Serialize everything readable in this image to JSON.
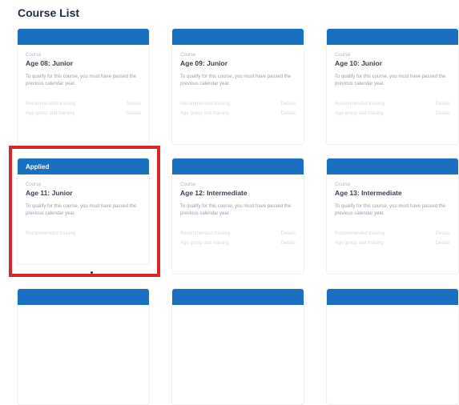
{
  "page": {
    "title": "Course List"
  },
  "courses": [
    {
      "header": "",
      "eyebrow": "Course",
      "title": "Age 08: Junior",
      "desc": "To qualify for this course, you must have passed the previous calendar year.",
      "row1_label": "Recommended training",
      "row1_value": "Details",
      "row2_label": "Age group and training",
      "row2_value": "Details"
    },
    {
      "header": "",
      "eyebrow": "Course",
      "title": "Age 09: Junior",
      "desc": "To qualify for this course, you must have passed the previous calendar year.",
      "row1_label": "Recommended training",
      "row1_value": "Details",
      "row2_label": "Age group and training",
      "row2_value": "Details"
    },
    {
      "header": "",
      "eyebrow": "Course",
      "title": "Age 10: Junior",
      "desc": "To qualify for this course, you must have passed the previous calendar year.",
      "row1_label": "Recommended training",
      "row1_value": "Details",
      "row2_label": "Age group and training",
      "row2_value": "Details"
    },
    {
      "header": "Applied",
      "eyebrow": "Course",
      "title": "Age 11: Junior",
      "desc": "To qualify for this course, you must have passed the previous calendar year.",
      "row1_label": "Recommended training",
      "row1_value": "",
      "row2_label": "",
      "row2_value": ""
    },
    {
      "header": "",
      "eyebrow": "Course",
      "title": "Age 12: Intermediate",
      "desc": "To qualify for this course, you must have passed the previous calendar year.",
      "row1_label": "Recommended training",
      "row1_value": "Details",
      "row2_label": "Age group and training",
      "row2_value": "Details"
    },
    {
      "header": "",
      "eyebrow": "Course",
      "title": "Age 13: Intermediate",
      "desc": "To qualify for this course, you must have passed the previous calendar year.",
      "row1_label": "Recommended training",
      "row1_value": "Details",
      "row2_label": "Age group and training",
      "row2_value": "Details"
    },
    {
      "header": "",
      "eyebrow": "",
      "title": "",
      "desc": "",
      "row1_label": "",
      "row1_value": "",
      "row2_label": "",
      "row2_value": ""
    },
    {
      "header": "",
      "eyebrow": "",
      "title": "",
      "desc": "",
      "row1_label": "",
      "row1_value": "",
      "row2_label": "",
      "row2_value": ""
    },
    {
      "header": "",
      "eyebrow": "",
      "title": "",
      "desc": "",
      "row1_label": "",
      "row1_value": "",
      "row2_label": "",
      "row2_value": ""
    }
  ],
  "colors": {
    "accent": "#1a6fc0",
    "highlight": "#d8262e",
    "title": "#1f2a44"
  }
}
